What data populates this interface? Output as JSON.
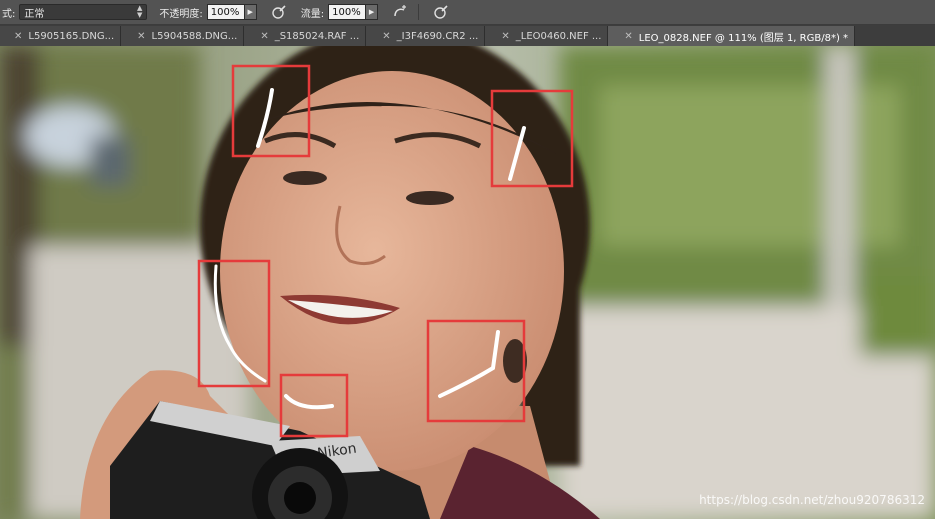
{
  "options": {
    "mode_label": "式:",
    "mode_value": "正常",
    "opacity_label": "不透明度:",
    "opacity_value": "100%",
    "flow_label": "流量:",
    "flow_value": "100%"
  },
  "tabs": [
    {
      "label": "L5905165.DNG..."
    },
    {
      "label": "L5904588.DNG..."
    },
    {
      "label": "_S185024.RAF ..."
    },
    {
      "label": "_I3F4690.CR2 ..."
    },
    {
      "label": "_LEO0460.NEF ..."
    },
    {
      "label": "LEO_0828.NEF @ 111% (图层 1, RGB/8*) *"
    }
  ],
  "watermark": "https://blog.csdn.net/zhou920786312",
  "colors": {
    "toolbar": "#535353",
    "tab_active": "#5d5d5d",
    "annotation_box": "#e53b3b"
  }
}
